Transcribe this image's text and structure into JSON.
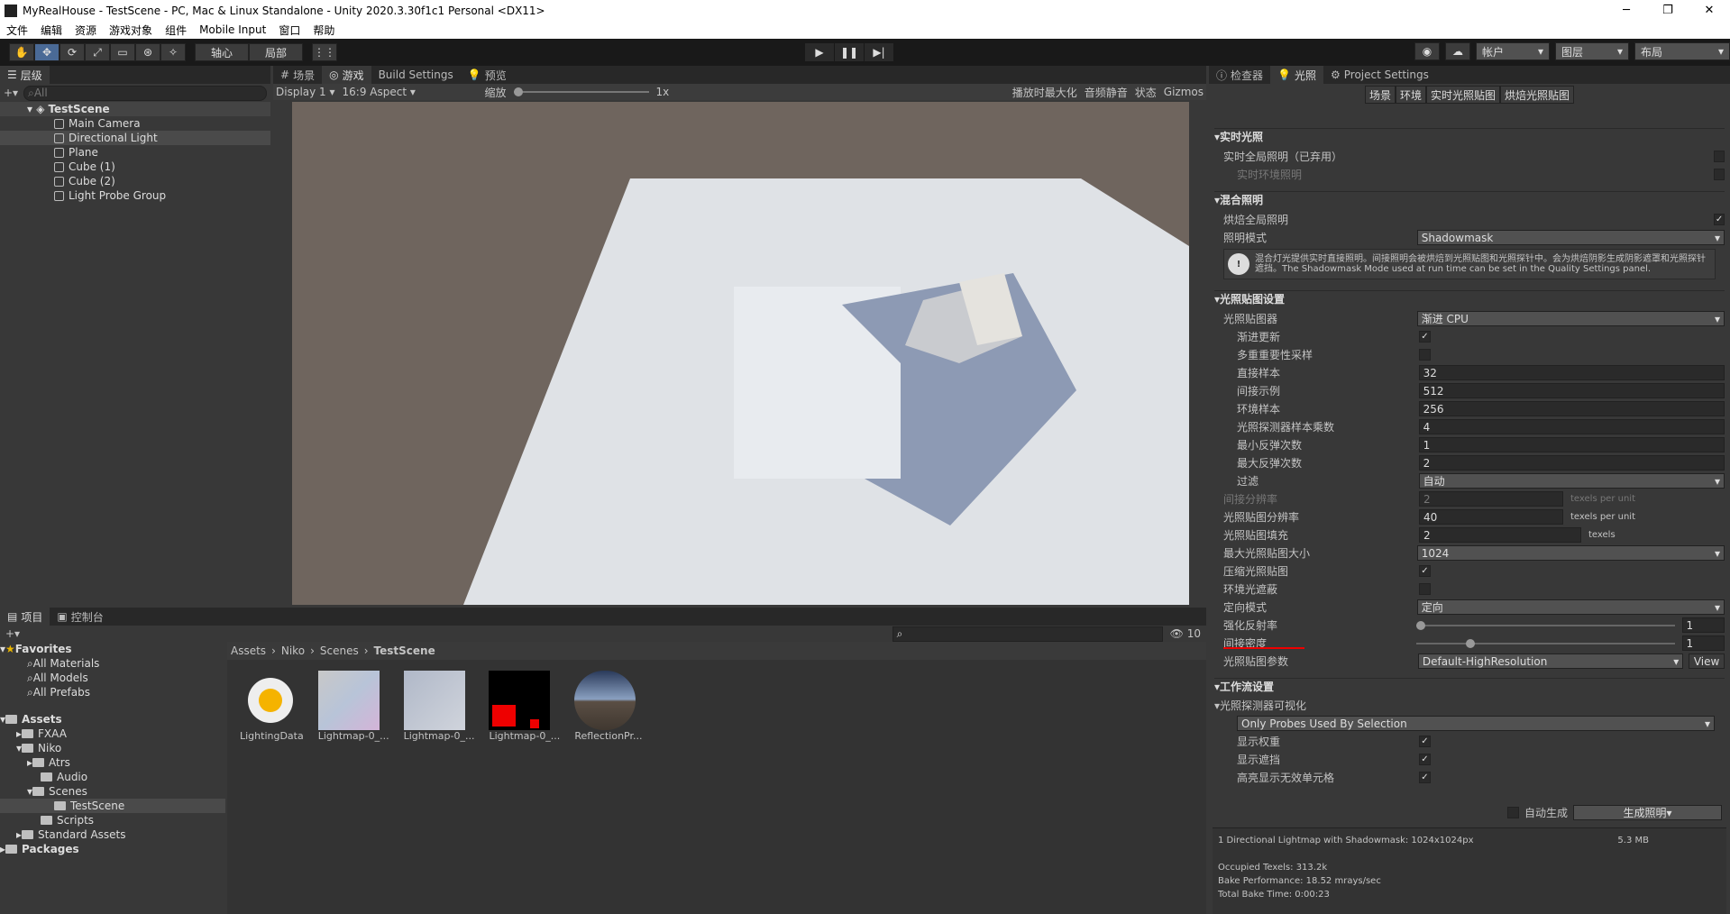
{
  "title": "MyRealHouse - TestScene - PC, Mac & Linux Standalone - Unity 2020.3.30f1c1 Personal <DX11>",
  "menu": [
    "文件",
    "编辑",
    "资源",
    "游戏对象",
    "组件",
    "Mobile Input",
    "窗口",
    "帮助"
  ],
  "toolbar": {
    "pivot": "轴心",
    "local": "局部",
    "account": "帐户",
    "layers": "图层",
    "layout": "布局"
  },
  "hierarchy": {
    "tab": "层级",
    "search_placeholder": "All",
    "scene": "TestScene",
    "items": [
      "Main Camera",
      "Directional Light",
      "Plane",
      "Cube (1)",
      "Cube (2)",
      "Light Probe Group"
    ]
  },
  "game": {
    "tabs": [
      "场景",
      "游戏",
      "Build Settings",
      "预览"
    ],
    "display": "Display 1",
    "aspect": "16:9 Aspect",
    "zoom_label": "缩放",
    "zoom": "1x",
    "maximize": "播放时最大化",
    "mute": "音频静音",
    "stats": "状态",
    "gizmos": "Gizmos"
  },
  "project": {
    "tabs": [
      "项目",
      "控制台"
    ],
    "count": "10",
    "favorites": "Favorites",
    "fav_items": [
      "All Materials",
      "All Models",
      "All Prefabs"
    ],
    "assets": "Assets",
    "tree": [
      "FXAA",
      "Niko",
      "Atrs",
      "Audio",
      "Scenes",
      "TestScene",
      "Scripts",
      "Standard Assets"
    ],
    "packages": "Packages",
    "breadcrumb": [
      "Assets",
      "Niko",
      "Scenes",
      "TestScene"
    ],
    "files": [
      "LightingData",
      "Lightmap-0_...",
      "Lightmap-0_...",
      "Lightmap-0_...",
      "ReflectionPr..."
    ]
  },
  "inspector": {
    "tabs": [
      "检查器",
      "光照",
      "Project Settings"
    ],
    "subtabs": [
      "场景",
      "环境",
      "实时光照贴图",
      "烘焙光照贴图"
    ],
    "realtime": {
      "title": "实时光照",
      "gi": "实时全局照明（已弃用）",
      "env": "实时环境照明"
    },
    "mixed": {
      "title": "混合照明",
      "baked_gi": "烘焙全局照明",
      "mode_label": "照明模式",
      "mode": "Shadowmask",
      "help": "混合灯光提供实时直接照明。间接照明会被烘焙到光照贴图和光照探针中。会为烘焙阴影生成阴影遮罩和光照探针遮挡。The Shadowmask Mode used at run time can be set in the Quality Settings panel."
    },
    "lm": {
      "title": "光照贴图设置",
      "lightmapper_label": "光照贴图器",
      "lightmapper": "渐进 CPU",
      "progressive": "渐进更新",
      "mis": "多重重要性采样",
      "direct_label": "直接样本",
      "direct": "32",
      "indirect_label": "间接示例",
      "indirect": "512",
      "env_label": "环境样本",
      "env": "256",
      "probe_label": "光照探测器样本乘数",
      "probe": "4",
      "minb_label": "最小反弹次数",
      "minb": "1",
      "maxb_label": "最大反弹次数",
      "maxb": "2",
      "filter_label": "过滤",
      "filter": "自动",
      "ind_res_label": "间接分辨率",
      "ind_res": "2",
      "texels_unit": "texels per unit",
      "lm_res_label": "光照贴图分辨率",
      "lm_res": "40",
      "pad_label": "光照贴图填充",
      "pad": "2",
      "texels": "texels",
      "max_size_label": "最大光照贴图大小",
      "max_size": "1024",
      "compress": "压缩光照贴图",
      "ao": "环境光遮蔽",
      "dir_label": "定向模式",
      "dir": "定向",
      "albedo_label": "强化反射率",
      "albedo": "1",
      "ind_int_label": "间接密度",
      "ind_int": "1",
      "params_label": "光照贴图参数",
      "params": "Default-HighResolution",
      "view": "View"
    },
    "workflow": {
      "title": "工作流设置",
      "probe_vis": "光照探测器可视化",
      "probe_mode": "Only Probes Used By Selection",
      "weights": "显示权重",
      "occl": "显示遮挡",
      "invalid": "高亮显示无效单元格"
    },
    "auto": "自动生成",
    "generate": "生成照明",
    "stats": [
      "1 Directional Lightmap with Shadowmask: 1024x1024px",
      "Occupied Texels: 313.2k",
      "Bake Performance: 18.52 mrays/sec",
      "Total Bake Time: 0:00:23"
    ],
    "size": "5.3 MB"
  }
}
